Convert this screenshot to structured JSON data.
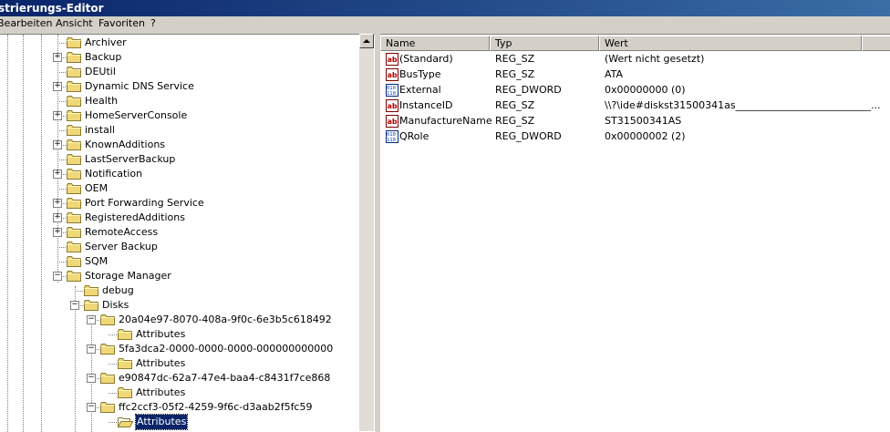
{
  "window": {
    "title": "strierungs-Editor"
  },
  "menu": [
    "Bearbeiten",
    "Ansicht",
    "Favoriten",
    "?"
  ],
  "tree": [
    {
      "label": "Archiver",
      "expander": ""
    },
    {
      "label": "Backup",
      "expander": "+"
    },
    {
      "label": "DEUtil",
      "expander": ""
    },
    {
      "label": "Dynamic DNS Service",
      "expander": "+"
    },
    {
      "label": "Health",
      "expander": ""
    },
    {
      "label": "HomeServerConsole",
      "expander": "+"
    },
    {
      "label": "install",
      "expander": ""
    },
    {
      "label": "KnownAdditions",
      "expander": "+"
    },
    {
      "label": "LastServerBackup",
      "expander": ""
    },
    {
      "label": "Notification",
      "expander": "+"
    },
    {
      "label": "OEM",
      "expander": ""
    },
    {
      "label": "Port Forwarding Service",
      "expander": "+"
    },
    {
      "label": "RegisteredAdditions",
      "expander": "+"
    },
    {
      "label": "RemoteAccess",
      "expander": "+"
    },
    {
      "label": "Server Backup",
      "expander": ""
    },
    {
      "label": "SQM",
      "expander": ""
    },
    {
      "label": "Storage Manager",
      "expander": "−"
    },
    {
      "label": "debug",
      "expander": ""
    },
    {
      "label": "Disks",
      "expander": "−"
    },
    {
      "label": "20a04e97-8070-408a-9f0c-6e3b5c618492",
      "expander": "−"
    },
    {
      "label": "Attributes",
      "expander": ""
    },
    {
      "label": "5fa3dca2-0000-0000-0000-000000000000",
      "expander": "−"
    },
    {
      "label": "Attributes",
      "expander": ""
    },
    {
      "label": "e90847dc-62a7-47e4-baa4-c8431f7ce868",
      "expander": "−"
    },
    {
      "label": "Attributes",
      "expander": ""
    },
    {
      "label": "ffc2ccf3-05f2-4259-9f6c-d3aab2f5fc59",
      "expander": "−"
    },
    {
      "label": "Attributes",
      "expander": "",
      "selected": true
    }
  ],
  "list": {
    "columns": [
      "Name",
      "Typ",
      "Wert"
    ],
    "rows": [
      {
        "icon": "string-value-icon",
        "name": "(Standard)",
        "type": "REG_SZ",
        "value": "(Wert nicht gesetzt)"
      },
      {
        "icon": "string-value-icon",
        "name": "BusType",
        "type": "REG_SZ",
        "value": "ATA"
      },
      {
        "icon": "dword-value-icon",
        "name": "External",
        "type": "REG_DWORD",
        "value": "0x00000000 (0)"
      },
      {
        "icon": "string-value-icon",
        "name": "InstanceID",
        "type": "REG_SZ",
        "value": "\\\\?\\ide#diskst31500341as___________________________..."
      },
      {
        "icon": "string-value-icon",
        "name": "ManufactureName",
        "type": "REG_SZ",
        "value": "ST31500341AS"
      },
      {
        "icon": "dword-value-icon",
        "name": "QRole",
        "type": "REG_DWORD",
        "value": "0x00000002 (2)"
      }
    ]
  }
}
